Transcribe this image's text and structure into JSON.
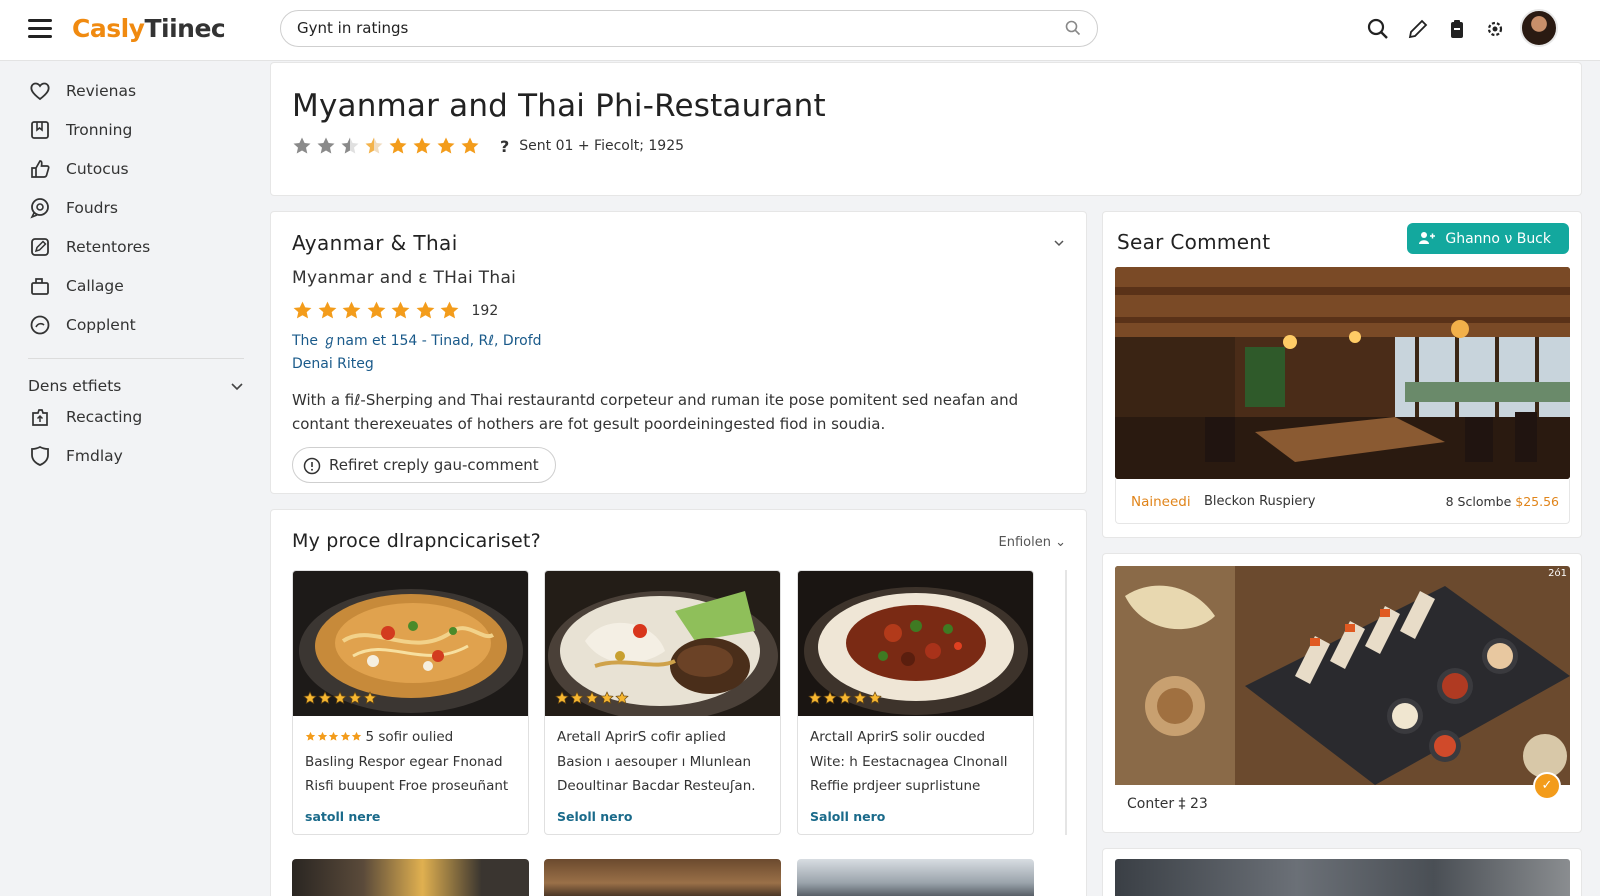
{
  "app": {
    "logo_part1": "Casly",
    "logo_part2": "Tiinec"
  },
  "search": {
    "value": "Gynt in ratings"
  },
  "sidebar": {
    "items": [
      {
        "label": "Revienas",
        "icon": "heart-icon"
      },
      {
        "label": "Tronning",
        "icon": "bookmark-icon"
      },
      {
        "label": "Cutocus",
        "icon": "thumbs-up-icon"
      },
      {
        "label": "Foudrs",
        "icon": "chat-bubble-icon"
      },
      {
        "label": "Retentores",
        "icon": "edit-icon"
      },
      {
        "label": "Callage",
        "icon": "bag-icon"
      },
      {
        "label": "Copplent",
        "icon": "comment-icon"
      }
    ],
    "section_label": "Dens etfiets",
    "section_items": [
      {
        "label": "Recacting",
        "icon": "share-icon"
      },
      {
        "label": "Fmdlay",
        "icon": "shield-icon"
      }
    ]
  },
  "header": {
    "title": "Myanmar and Thai Phi-Restaurant",
    "star_rating": 2.5,
    "star_colors": {
      "grey": "#8a8a8a",
      "orange": "#f39c1b"
    },
    "question_mark": "?",
    "meta": "Sent 01 + Fiecolt; 1925"
  },
  "info": {
    "title": "Ayanmar & Thai",
    "subtitle": "Myanmar and ε THai  Thai",
    "star_count_filled": 7,
    "rating_count": "192",
    "address": "The ℊnam et 154 - Tinad, Rℓ, Drofd",
    "link2": "Denai Riteg",
    "description": "With a fiℓ-Sherping and Thai restaurantd corpeteur and ruman ite pose pomitent sed neafan and contant therexeuates of hothers are fot gesult poordeiningested fiod in soudia.",
    "button_label": "Refiret creply gau-comment"
  },
  "dishes": {
    "title": "My proce dlrapncicariset?",
    "filter_label": "Enfiolen ⌄",
    "cards": [
      {
        "image": "noodle-bowl",
        "line1_suffix": "5 sofir oulied",
        "line1": "",
        "line2": "Basling Respor egear Fnonad",
        "line3": "Risfi buupent Froe proseuñant",
        "more": "satoll nere"
      },
      {
        "image": "rice-plate",
        "line1_suffix": "",
        "line1": "Aretall AprirS cofir aplied",
        "line2": "Basion ı aesouper ı Mlunlean",
        "line3": "Deoultinar Bacdar Resteuʃan.",
        "more": "Selоll nero"
      },
      {
        "image": "curry-plate",
        "line1_suffix": "",
        "line1": "Arctall AprirS solir oucded",
        "line2": "Wite: h Eestacnagea Clnonall",
        "line3": "Reffie prdjeer suprlistune",
        "more": "Saloll nero"
      }
    ]
  },
  "comment": {
    "title": "Sear Comment",
    "button_label": "Ghanno ν Buck",
    "user": "Naineedi",
    "place": "Bleckon Ruspiery",
    "right_text": "8 Sclombe",
    "price": "$25.56"
  },
  "photo_card": {
    "tag": "2ό1",
    "count_label": "Conter  ‡  23",
    "badge": "✓"
  },
  "colors": {
    "accent_orange": "#f39c1b",
    "teal": "#13a89e",
    "link_blue": "#1a5a8a"
  }
}
